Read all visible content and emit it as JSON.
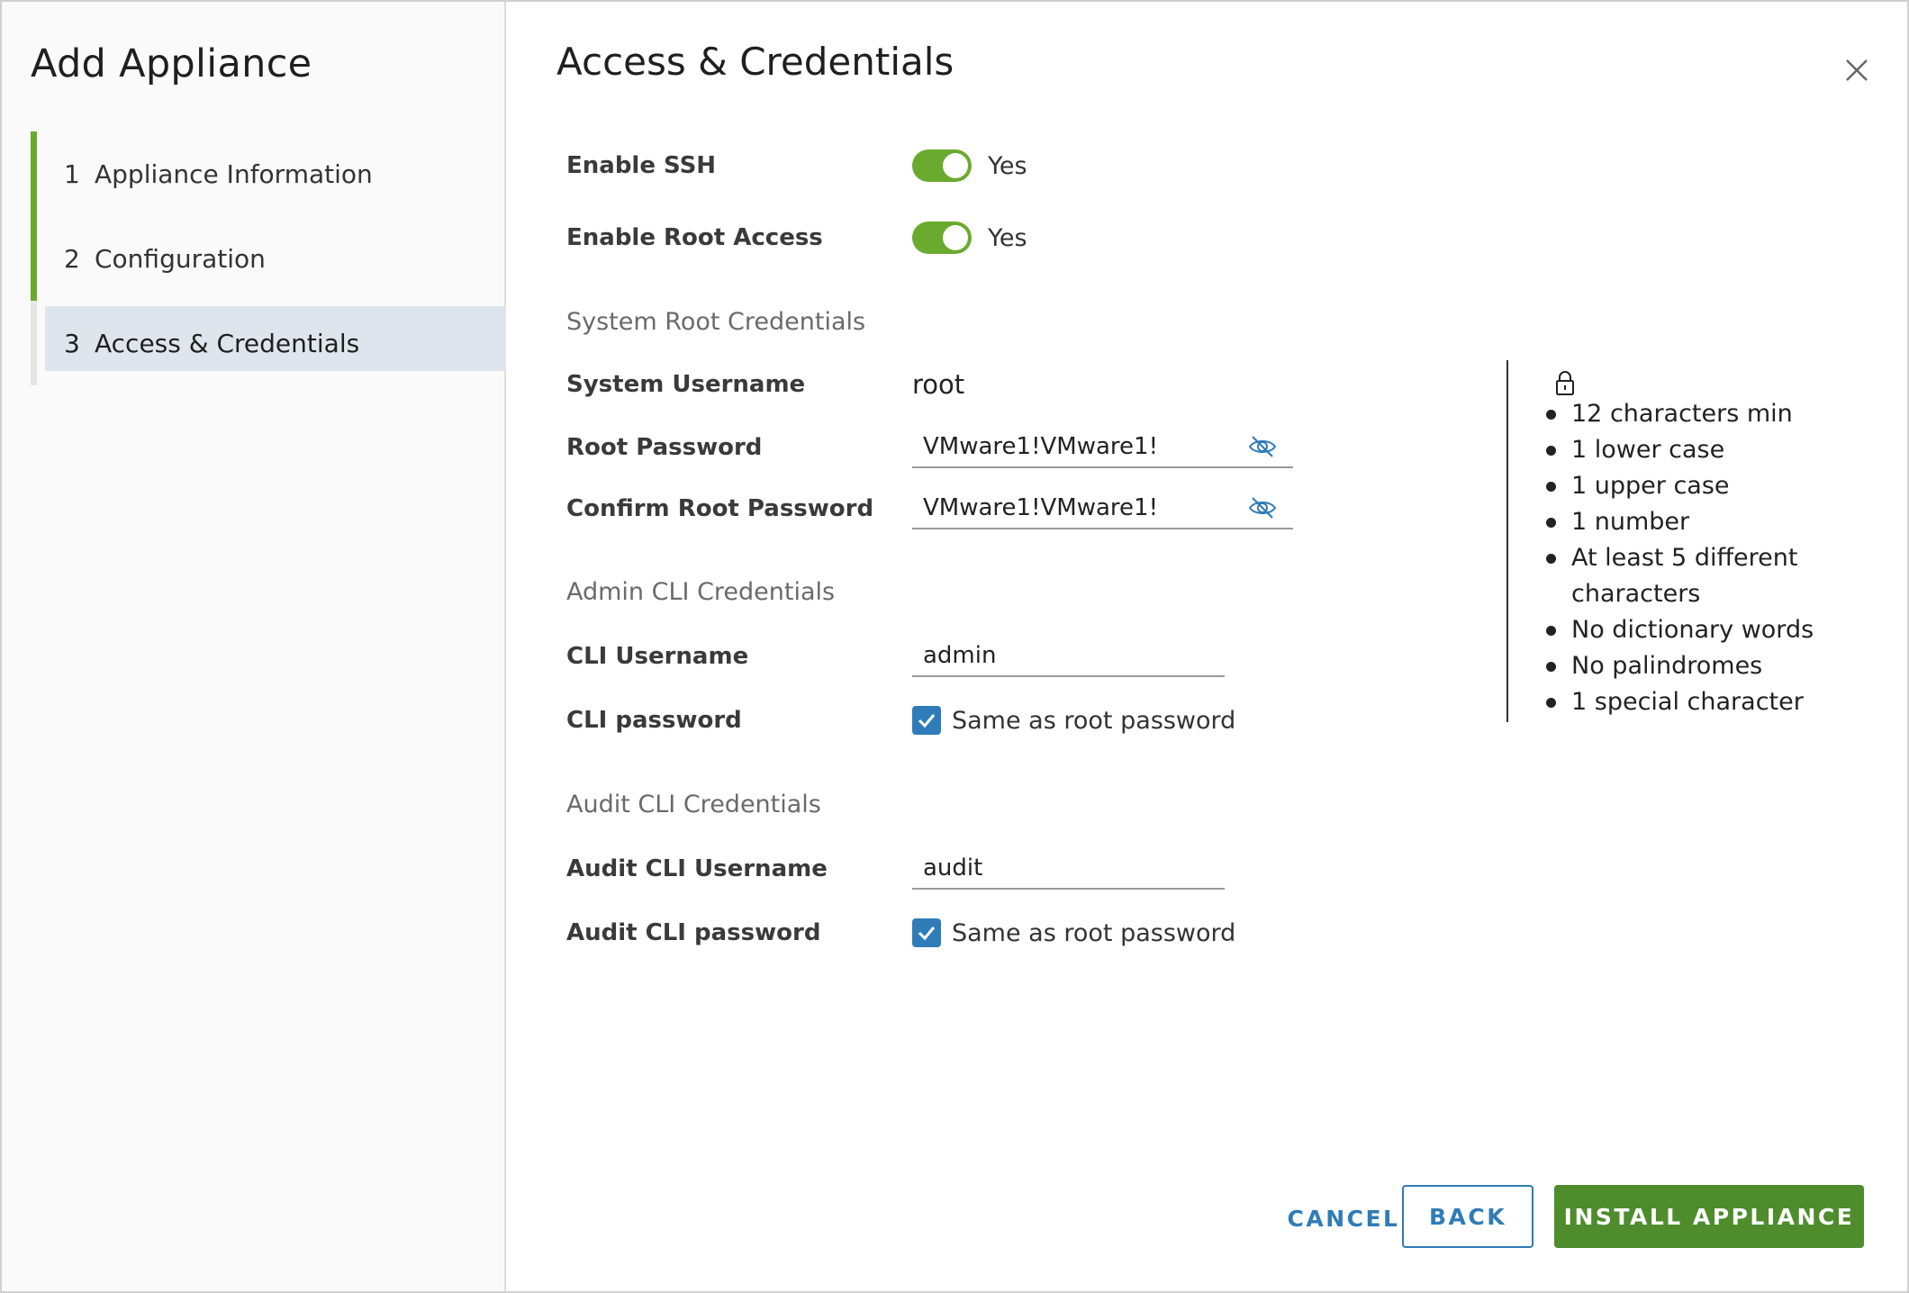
{
  "wizard": {
    "title": "Add Appliance"
  },
  "steps": [
    {
      "num": "1",
      "label": "Appliance Information",
      "state": "complete"
    },
    {
      "num": "2",
      "label": "Configuration",
      "state": "complete"
    },
    {
      "num": "3",
      "label": "Access & Credentials",
      "state": "active"
    }
  ],
  "page": {
    "title": "Access & Credentials"
  },
  "ssh": {
    "label": "Enable SSH",
    "value": "Yes",
    "enabled": true
  },
  "root_access": {
    "label": "Enable Root Access",
    "value": "Yes",
    "enabled": true
  },
  "system_root": {
    "heading": "System Root Credentials",
    "username_label": "System Username",
    "username_value": "root",
    "password_label": "Root Password",
    "password_value": "VMware1!VMware1!",
    "confirm_label": "Confirm Root Password",
    "confirm_value": "VMware1!VMware1!"
  },
  "admin_cli": {
    "heading": "Admin CLI Credentials",
    "username_label": "CLI Username",
    "username_value": "admin",
    "password_label": "CLI password",
    "same_as_root_label": "Same as root password",
    "same_as_root_checked": true
  },
  "audit_cli": {
    "heading": "Audit CLI Credentials",
    "username_label": "Audit CLI Username",
    "username_value": "audit",
    "password_label": "Audit CLI password",
    "same_as_root_label": "Same as root password",
    "same_as_root_checked": true
  },
  "password_rules": {
    "icon": "lock-icon",
    "items": [
      "12 characters min",
      "1 lower case",
      "1 upper case",
      "1 number",
      "At least 5 different characters",
      "No dictionary words",
      "No palindromes",
      "1 special character"
    ]
  },
  "footer": {
    "cancel": "CANCEL",
    "back": "BACK",
    "install": "INSTALL APPLIANCE"
  },
  "colors": {
    "accent_green": "#6aaa2e",
    "primary_green": "#4e8c2c",
    "link_blue": "#2f7cb8",
    "active_step_bg": "#dfe5ec"
  }
}
